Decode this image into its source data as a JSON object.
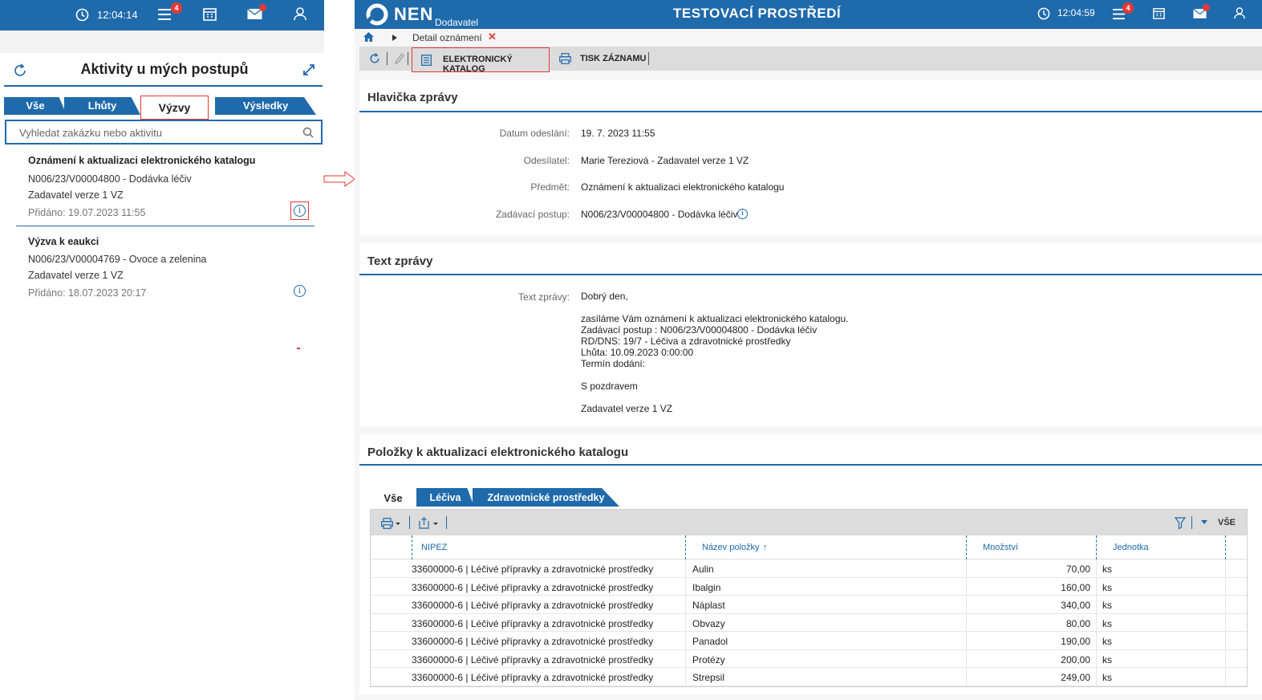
{
  "left": {
    "topbar": {
      "time": "12:04:14",
      "menu_badge": "4"
    },
    "panel_title": "Aktivity u mých postupů",
    "tabs": [
      "Vše",
      "Lhůty",
      "Výzvy",
      "Výsledky"
    ],
    "search_placeholder": "Vyhledat zakázku nebo aktivitu",
    "items": [
      {
        "title": "Oznámení k aktualizaci elektronického katalogu",
        "line1": "N006/23/V00004800 - Dodávka léčiv",
        "line2": "Zadavatel verze 1 VZ",
        "date": "Přidáno: 19.07.2023 11:55"
      },
      {
        "title": "Výzva k eaukci",
        "line1": "N006/23/V00004769 - Ovoce a zelenina",
        "line2": "Zadavatel verze 1 VZ",
        "date": "Přidáno: 18.07.2023 20:17"
      }
    ]
  },
  "right": {
    "topbar": {
      "logo": "NEN",
      "logo_sub": "Dodavatel",
      "env_title": "TESTOVACÍ PROSTŘEDÍ",
      "time": "12:04:59",
      "menu_badge": "4"
    },
    "breadcrumb": "Detail oznámení",
    "toolbar": {
      "catalog": "ELEKTRONICKÝ KATALOG",
      "print": "TISK ZÁZNAMU"
    },
    "header_section": {
      "title": "Hlavička zprávy",
      "rows": [
        {
          "label": "Datum odeslání:",
          "value": "19. 7. 2023 11:55"
        },
        {
          "label": "Odesílatel:",
          "value": "Marie  Tereziová - Zadavatel verze 1 VZ"
        },
        {
          "label": "Předmět:",
          "value": "Oznámení k aktualizaci elektronického katalogu"
        },
        {
          "label": "Zadávací postup:",
          "value": "N006/23/V00004800 - Dodávka léčiv"
        }
      ]
    },
    "text_section": {
      "title": "Text zprávy",
      "label": "Text zprávy:",
      "lines": [
        "Dobrý den,",
        "",
        "zasíláme Vám oznámení k aktualizaci elektronického katalogu.",
        "Zadávací postup : N006/23/V00004800 - Dodávka léčiv",
        "RD/DNS: 19/7 - Léčiva a zdravotnické prostředky",
        "Lhůta: 10.09.2023 0:00:00",
        "Termín dodání:",
        "",
        "S pozdravem",
        "",
        "Zadavatel verze 1 VZ"
      ]
    },
    "items_section": {
      "title": "Položky k aktualizaci elektronického katalogu",
      "tabs": [
        "Vše",
        "Léčiva",
        "Zdravotnické prostředky"
      ],
      "filter_label": "VŠE",
      "columns": [
        "NIPEZ",
        "Název položky",
        "Množství",
        "Jednotka"
      ],
      "rows": [
        [
          "33600000-6 | Léčivé přípravky a zdravotnické prostředky",
          "Aulin",
          "70,00",
          "ks"
        ],
        [
          "33600000-6 | Léčivé přípravky a zdravotnické prostředky",
          "Ibalgin",
          "160,00",
          "ks"
        ],
        [
          "33600000-6 | Léčivé přípravky a zdravotnické prostředky",
          "Náplast",
          "340,00",
          "ks"
        ],
        [
          "33600000-6 | Léčivé přípravky a zdravotnické prostředky",
          "Obvazy",
          "80,00",
          "ks"
        ],
        [
          "33600000-6 | Léčivé přípravky a zdravotnické prostředky",
          "Panadol",
          "190,00",
          "ks"
        ],
        [
          "33600000-6 | Léčivé přípravky a zdravotnické prostředky",
          "Protézy",
          "200,00",
          "ks"
        ],
        [
          "33600000-6 | Léčivé přípravky a zdravotnické prostředky",
          "Strepsil",
          "249,00",
          "ks"
        ]
      ]
    }
  },
  "colors": {
    "brand": "#1f6aab",
    "highlight": "#e53935"
  }
}
